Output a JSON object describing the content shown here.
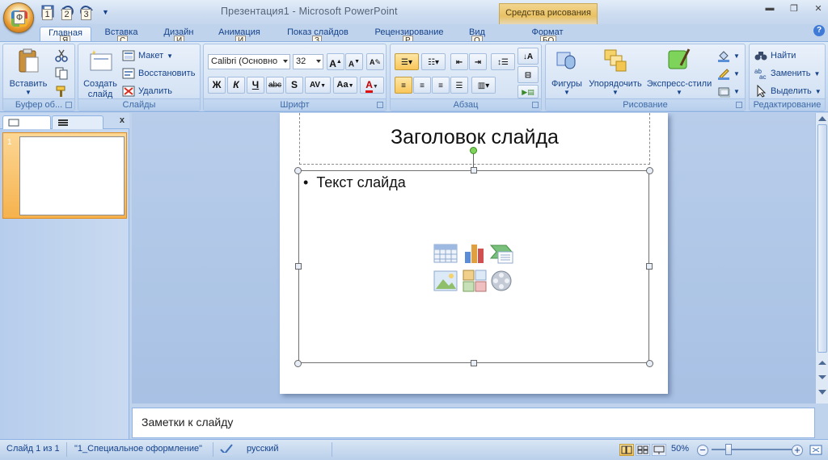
{
  "window": {
    "title": "Презентация1 - Microsoft PowerPoint",
    "context_tool": "Средства рисования"
  },
  "qat": {
    "keytips": [
      "1",
      "2",
      "3"
    ]
  },
  "office_button": {
    "keytip": "Ф"
  },
  "tabs": [
    {
      "label": "Главная",
      "keytip": "Я",
      "active": true
    },
    {
      "label": "Вставка",
      "keytip": "С"
    },
    {
      "label": "Дизайн",
      "keytip": "И"
    },
    {
      "label": "Анимация",
      "keytip": "И"
    },
    {
      "label": "Показ слайдов",
      "keytip": "З"
    },
    {
      "label": "Рецензирование",
      "keytip": "Р"
    },
    {
      "label": "Вид",
      "keytip": "О"
    },
    {
      "label": "Формат",
      "keytip": "БО"
    }
  ],
  "ribbon": {
    "clipboard": {
      "label": "Буфер об...",
      "paste": "Вставить"
    },
    "slides": {
      "label": "Слайды",
      "new_slide": "Создать слайд",
      "layout": "Макет",
      "reset": "Восстановить",
      "delete": "Удалить"
    },
    "font": {
      "label": "Шрифт",
      "font_name": "Calibri (Основно",
      "font_size": "32",
      "bold": "Ж",
      "italic": "К",
      "underline": "Ч",
      "strike": "abc",
      "shadow": "S",
      "spacing": "AV",
      "case": "Aa",
      "color": "A",
      "grow": "A",
      "shrink": "A"
    },
    "paragraph": {
      "label": "Абзац"
    },
    "drawing": {
      "label": "Рисование",
      "shapes": "Фигуры",
      "arrange": "Упорядочить",
      "quick_styles": "Экспресс-стили"
    },
    "editing": {
      "label": "Редактирование",
      "find": "Найти",
      "replace": "Заменить",
      "select": "Выделить"
    }
  },
  "slide": {
    "title": "Заголовок слайда",
    "body_text": "Текст слайда",
    "bullet": "•",
    "thumbnail_number": "1"
  },
  "notes": {
    "text": "Заметки к слайду"
  },
  "status": {
    "slide_counter": "Слайд 1 из 1",
    "theme": "\"1_Специальное оформление\"",
    "language": "русский",
    "zoom": "50%",
    "zoom_level_percent": 50
  },
  "colors": {
    "accent_orange": "#f6b24d",
    "ribbon_blue": "#c8dbf2",
    "context_gold": "#e9c163",
    "rotate_handle": "#7ed35a"
  }
}
